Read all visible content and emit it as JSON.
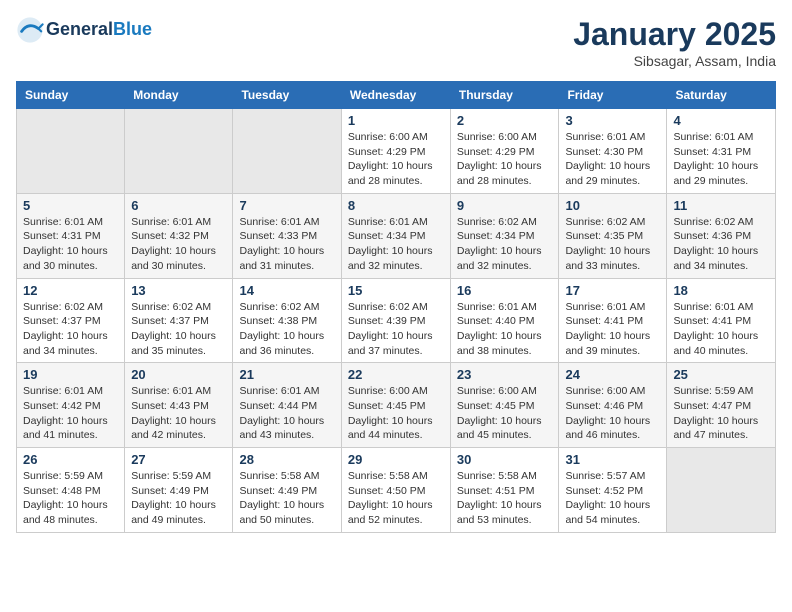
{
  "header": {
    "logo_line1": "General",
    "logo_line2": "Blue",
    "month_title": "January 2025",
    "subtitle": "Sibsagar, Assam, India"
  },
  "weekdays": [
    "Sunday",
    "Monday",
    "Tuesday",
    "Wednesday",
    "Thursday",
    "Friday",
    "Saturday"
  ],
  "weeks": [
    [
      {
        "day": "",
        "sunrise": "",
        "sunset": "",
        "daylight": ""
      },
      {
        "day": "",
        "sunrise": "",
        "sunset": "",
        "daylight": ""
      },
      {
        "day": "",
        "sunrise": "",
        "sunset": "",
        "daylight": ""
      },
      {
        "day": "1",
        "sunrise": "Sunrise: 6:00 AM",
        "sunset": "Sunset: 4:29 PM",
        "daylight": "Daylight: 10 hours and 28 minutes."
      },
      {
        "day": "2",
        "sunrise": "Sunrise: 6:00 AM",
        "sunset": "Sunset: 4:29 PM",
        "daylight": "Daylight: 10 hours and 28 minutes."
      },
      {
        "day": "3",
        "sunrise": "Sunrise: 6:01 AM",
        "sunset": "Sunset: 4:30 PM",
        "daylight": "Daylight: 10 hours and 29 minutes."
      },
      {
        "day": "4",
        "sunrise": "Sunrise: 6:01 AM",
        "sunset": "Sunset: 4:31 PM",
        "daylight": "Daylight: 10 hours and 29 minutes."
      }
    ],
    [
      {
        "day": "5",
        "sunrise": "Sunrise: 6:01 AM",
        "sunset": "Sunset: 4:31 PM",
        "daylight": "Daylight: 10 hours and 30 minutes."
      },
      {
        "day": "6",
        "sunrise": "Sunrise: 6:01 AM",
        "sunset": "Sunset: 4:32 PM",
        "daylight": "Daylight: 10 hours and 30 minutes."
      },
      {
        "day": "7",
        "sunrise": "Sunrise: 6:01 AM",
        "sunset": "Sunset: 4:33 PM",
        "daylight": "Daylight: 10 hours and 31 minutes."
      },
      {
        "day": "8",
        "sunrise": "Sunrise: 6:01 AM",
        "sunset": "Sunset: 4:34 PM",
        "daylight": "Daylight: 10 hours and 32 minutes."
      },
      {
        "day": "9",
        "sunrise": "Sunrise: 6:02 AM",
        "sunset": "Sunset: 4:34 PM",
        "daylight": "Daylight: 10 hours and 32 minutes."
      },
      {
        "day": "10",
        "sunrise": "Sunrise: 6:02 AM",
        "sunset": "Sunset: 4:35 PM",
        "daylight": "Daylight: 10 hours and 33 minutes."
      },
      {
        "day": "11",
        "sunrise": "Sunrise: 6:02 AM",
        "sunset": "Sunset: 4:36 PM",
        "daylight": "Daylight: 10 hours and 34 minutes."
      }
    ],
    [
      {
        "day": "12",
        "sunrise": "Sunrise: 6:02 AM",
        "sunset": "Sunset: 4:37 PM",
        "daylight": "Daylight: 10 hours and 34 minutes."
      },
      {
        "day": "13",
        "sunrise": "Sunrise: 6:02 AM",
        "sunset": "Sunset: 4:37 PM",
        "daylight": "Daylight: 10 hours and 35 minutes."
      },
      {
        "day": "14",
        "sunrise": "Sunrise: 6:02 AM",
        "sunset": "Sunset: 4:38 PM",
        "daylight": "Daylight: 10 hours and 36 minutes."
      },
      {
        "day": "15",
        "sunrise": "Sunrise: 6:02 AM",
        "sunset": "Sunset: 4:39 PM",
        "daylight": "Daylight: 10 hours and 37 minutes."
      },
      {
        "day": "16",
        "sunrise": "Sunrise: 6:01 AM",
        "sunset": "Sunset: 4:40 PM",
        "daylight": "Daylight: 10 hours and 38 minutes."
      },
      {
        "day": "17",
        "sunrise": "Sunrise: 6:01 AM",
        "sunset": "Sunset: 4:41 PM",
        "daylight": "Daylight: 10 hours and 39 minutes."
      },
      {
        "day": "18",
        "sunrise": "Sunrise: 6:01 AM",
        "sunset": "Sunset: 4:41 PM",
        "daylight": "Daylight: 10 hours and 40 minutes."
      }
    ],
    [
      {
        "day": "19",
        "sunrise": "Sunrise: 6:01 AM",
        "sunset": "Sunset: 4:42 PM",
        "daylight": "Daylight: 10 hours and 41 minutes."
      },
      {
        "day": "20",
        "sunrise": "Sunrise: 6:01 AM",
        "sunset": "Sunset: 4:43 PM",
        "daylight": "Daylight: 10 hours and 42 minutes."
      },
      {
        "day": "21",
        "sunrise": "Sunrise: 6:01 AM",
        "sunset": "Sunset: 4:44 PM",
        "daylight": "Daylight: 10 hours and 43 minutes."
      },
      {
        "day": "22",
        "sunrise": "Sunrise: 6:00 AM",
        "sunset": "Sunset: 4:45 PM",
        "daylight": "Daylight: 10 hours and 44 minutes."
      },
      {
        "day": "23",
        "sunrise": "Sunrise: 6:00 AM",
        "sunset": "Sunset: 4:45 PM",
        "daylight": "Daylight: 10 hours and 45 minutes."
      },
      {
        "day": "24",
        "sunrise": "Sunrise: 6:00 AM",
        "sunset": "Sunset: 4:46 PM",
        "daylight": "Daylight: 10 hours and 46 minutes."
      },
      {
        "day": "25",
        "sunrise": "Sunrise: 5:59 AM",
        "sunset": "Sunset: 4:47 PM",
        "daylight": "Daylight: 10 hours and 47 minutes."
      }
    ],
    [
      {
        "day": "26",
        "sunrise": "Sunrise: 5:59 AM",
        "sunset": "Sunset: 4:48 PM",
        "daylight": "Daylight: 10 hours and 48 minutes."
      },
      {
        "day": "27",
        "sunrise": "Sunrise: 5:59 AM",
        "sunset": "Sunset: 4:49 PM",
        "daylight": "Daylight: 10 hours and 49 minutes."
      },
      {
        "day": "28",
        "sunrise": "Sunrise: 5:58 AM",
        "sunset": "Sunset: 4:49 PM",
        "daylight": "Daylight: 10 hours and 50 minutes."
      },
      {
        "day": "29",
        "sunrise": "Sunrise: 5:58 AM",
        "sunset": "Sunset: 4:50 PM",
        "daylight": "Daylight: 10 hours and 52 minutes."
      },
      {
        "day": "30",
        "sunrise": "Sunrise: 5:58 AM",
        "sunset": "Sunset: 4:51 PM",
        "daylight": "Daylight: 10 hours and 53 minutes."
      },
      {
        "day": "31",
        "sunrise": "Sunrise: 5:57 AM",
        "sunset": "Sunset: 4:52 PM",
        "daylight": "Daylight: 10 hours and 54 minutes."
      },
      {
        "day": "",
        "sunrise": "",
        "sunset": "",
        "daylight": ""
      }
    ]
  ]
}
